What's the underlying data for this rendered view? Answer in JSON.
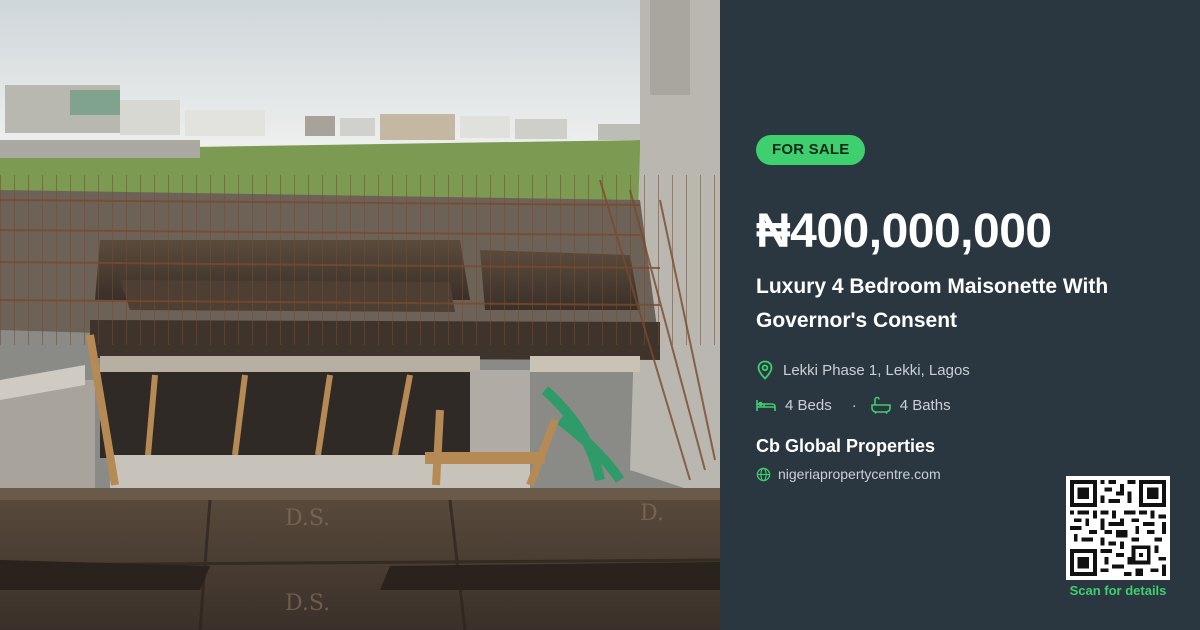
{
  "listing": {
    "status_badge": "FOR SALE",
    "price": "₦400,000,000",
    "title": "Luxury 4 Bedroom Maisonette With Governor's Consent",
    "location": "Lekki Phase 1, Lekki, Lagos",
    "beds": "4 Beds",
    "baths": "4 Baths",
    "separator": "·",
    "agent": "Cb Global Properties",
    "website": "nigeriapropertycentre.com",
    "qr_caption": "Scan for details"
  },
  "icons": {
    "location": "map-pin-icon",
    "beds": "bed-icon",
    "baths": "bathtub-icon",
    "website": "globe-icon",
    "qr": "qr-code"
  },
  "colors": {
    "panel_bg": "#2b3740",
    "accent": "#3ecf6e",
    "text_primary": "#ffffff",
    "text_secondary": "#c9d1d6"
  }
}
